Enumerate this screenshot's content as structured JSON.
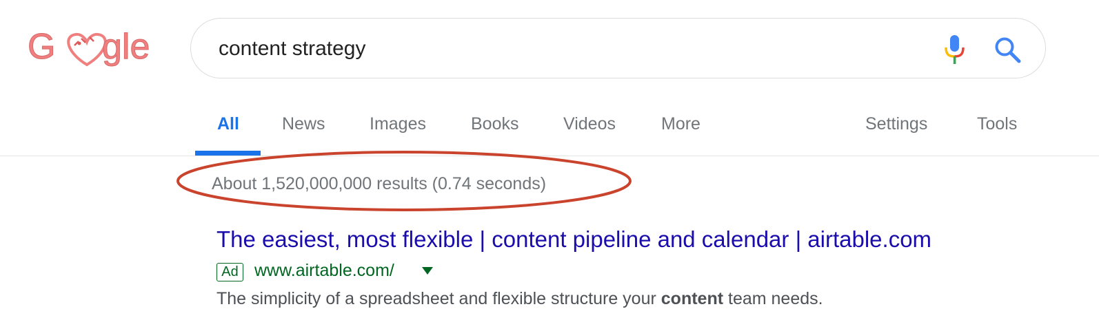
{
  "logo": {
    "alt": "Google"
  },
  "search": {
    "query": "content strategy"
  },
  "tabs": [
    {
      "label": "All",
      "active": true
    },
    {
      "label": "News"
    },
    {
      "label": "Images"
    },
    {
      "label": "Books"
    },
    {
      "label": "Videos"
    },
    {
      "label": "More"
    }
  ],
  "tools": {
    "settings_label": "Settings",
    "tools_label": "Tools"
  },
  "results": {
    "stats": "About 1,520,000,000 results (0.74 seconds)"
  },
  "ad": {
    "title": "The easiest, most flexible | content pipeline and calendar | airtable.com",
    "badge": "Ad",
    "url": "www.airtable.com/",
    "description_pre": "The simplicity of a spreadsheet and flexible structure your ",
    "description_bold": "content",
    "description_post": " team needs."
  },
  "colors": {
    "logo": "#f08080",
    "active_tab": "#1a73e8",
    "link": "#1a0dab",
    "url_green": "#006621",
    "annotation": "#c9432d"
  },
  "icons": [
    "microphone-icon",
    "search-icon",
    "dropdown-caret-icon"
  ]
}
